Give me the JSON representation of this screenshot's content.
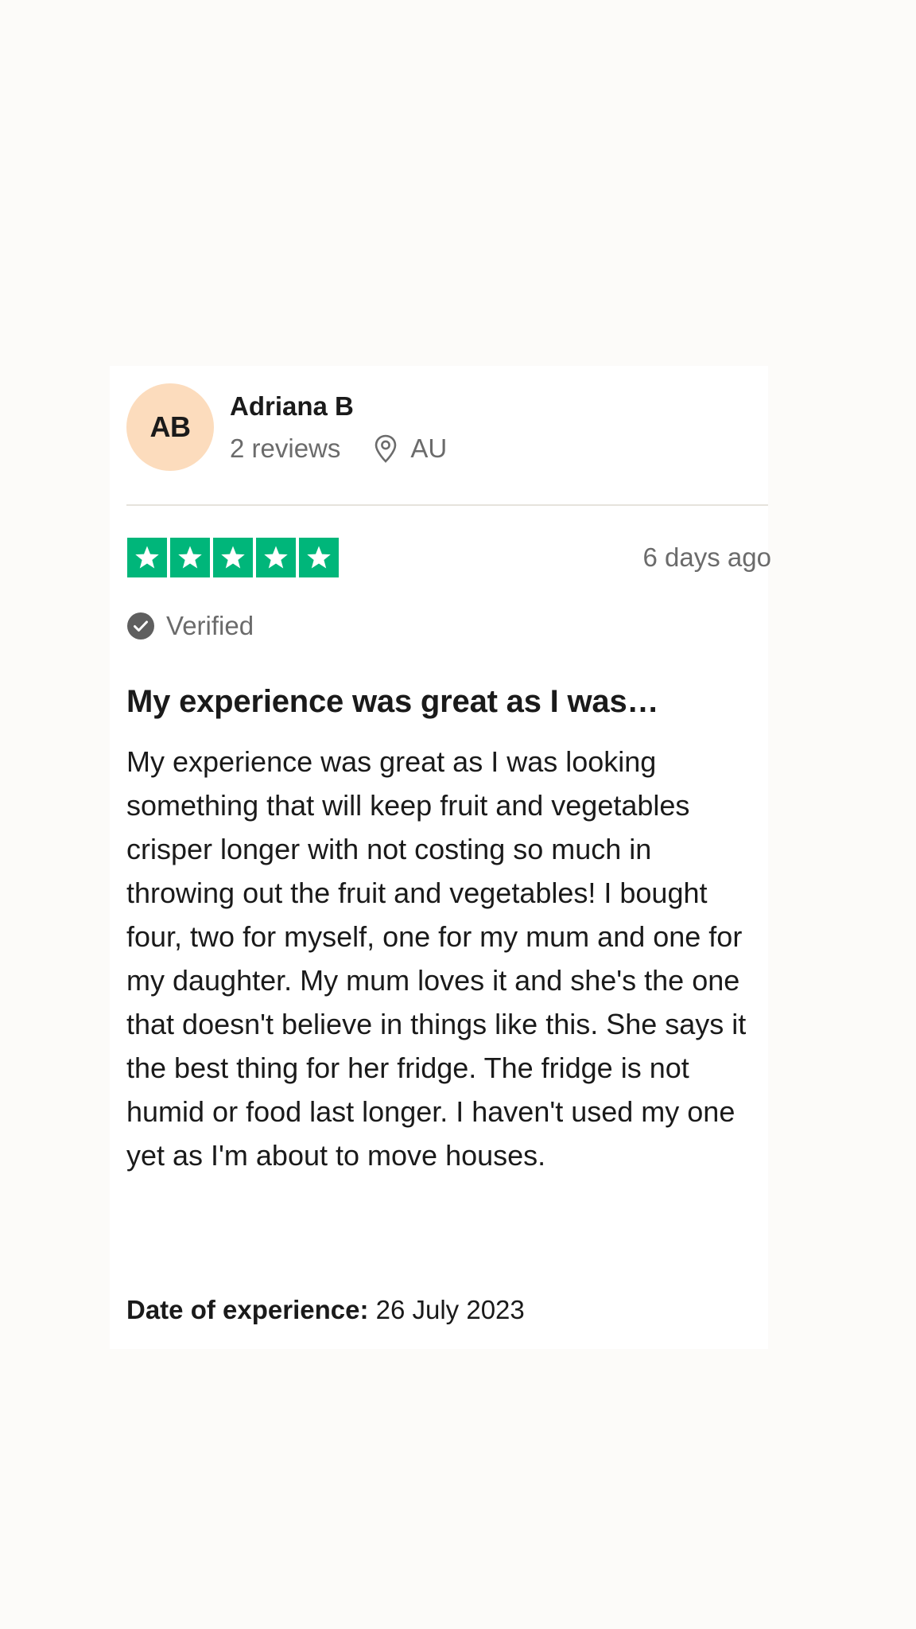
{
  "reviewer": {
    "initials": "AB",
    "name": "Adriana B",
    "review_count": "2 reviews",
    "country": "AU",
    "avatar_color": "#fcdcbd"
  },
  "rating": {
    "stars": 5,
    "max_stars": 5,
    "star_color": "#00b67a"
  },
  "posted": "6 days ago",
  "verified_label": "Verified",
  "review": {
    "title": "My experience was great as I was…",
    "body": "My experience was great as I was looking something that will keep fruit and vegetables crisper longer with not costing so much in throwing out the fruit and vegetables! I bought four, two for myself, one for my mum and one for my daughter. My mum loves it and she's the one that doesn't believe in things like this. She says it the best thing for her fridge. The fridge is not humid or food last longer. I haven't used my one yet as I'm about to move houses."
  },
  "experience": {
    "label": "Date of experience:",
    "date": "26 July 2023"
  },
  "icons": {
    "location": "location-pin-icon",
    "verified": "check-circle-icon",
    "star": "star-icon"
  }
}
